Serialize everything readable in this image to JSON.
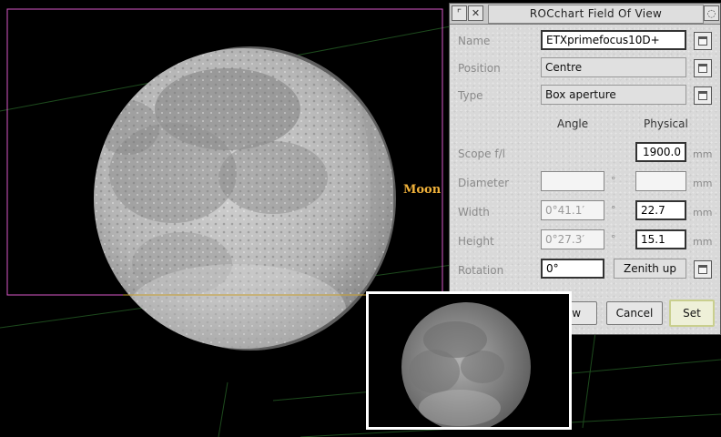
{
  "sky_label": "Moon",
  "colors": {
    "fov_box": "#d957c9",
    "horizon": "#c8a030",
    "grid": "#1d4a1d",
    "label": "#f0b13a"
  },
  "dialog": {
    "title": "ROCchart Field Of View",
    "labels": {
      "name": "Name",
      "position": "Position",
      "type": "Type",
      "scope": "Scope f/l",
      "diameter": "Diameter",
      "width": "Width",
      "height": "Height",
      "rotation": "Rotation"
    },
    "headers": {
      "angle": "Angle",
      "physical": "Physical"
    },
    "values": {
      "name": "ETXprimefocus10D+",
      "position": "Centre",
      "type": "Box aperture",
      "scope_fl": "1900.0",
      "diameter_angle": "",
      "diameter_phys": "",
      "width_angle": "0°41.1′",
      "width_phys": "22.7",
      "height_angle": "0°27.3′",
      "height_phys": "15.1",
      "rotation": "0°",
      "rotation_mode": "Zenith up"
    },
    "units": {
      "degree": "°",
      "mm": "mm"
    },
    "buttons": {
      "new": "New",
      "cancel": "Cancel",
      "set": "Set"
    }
  }
}
